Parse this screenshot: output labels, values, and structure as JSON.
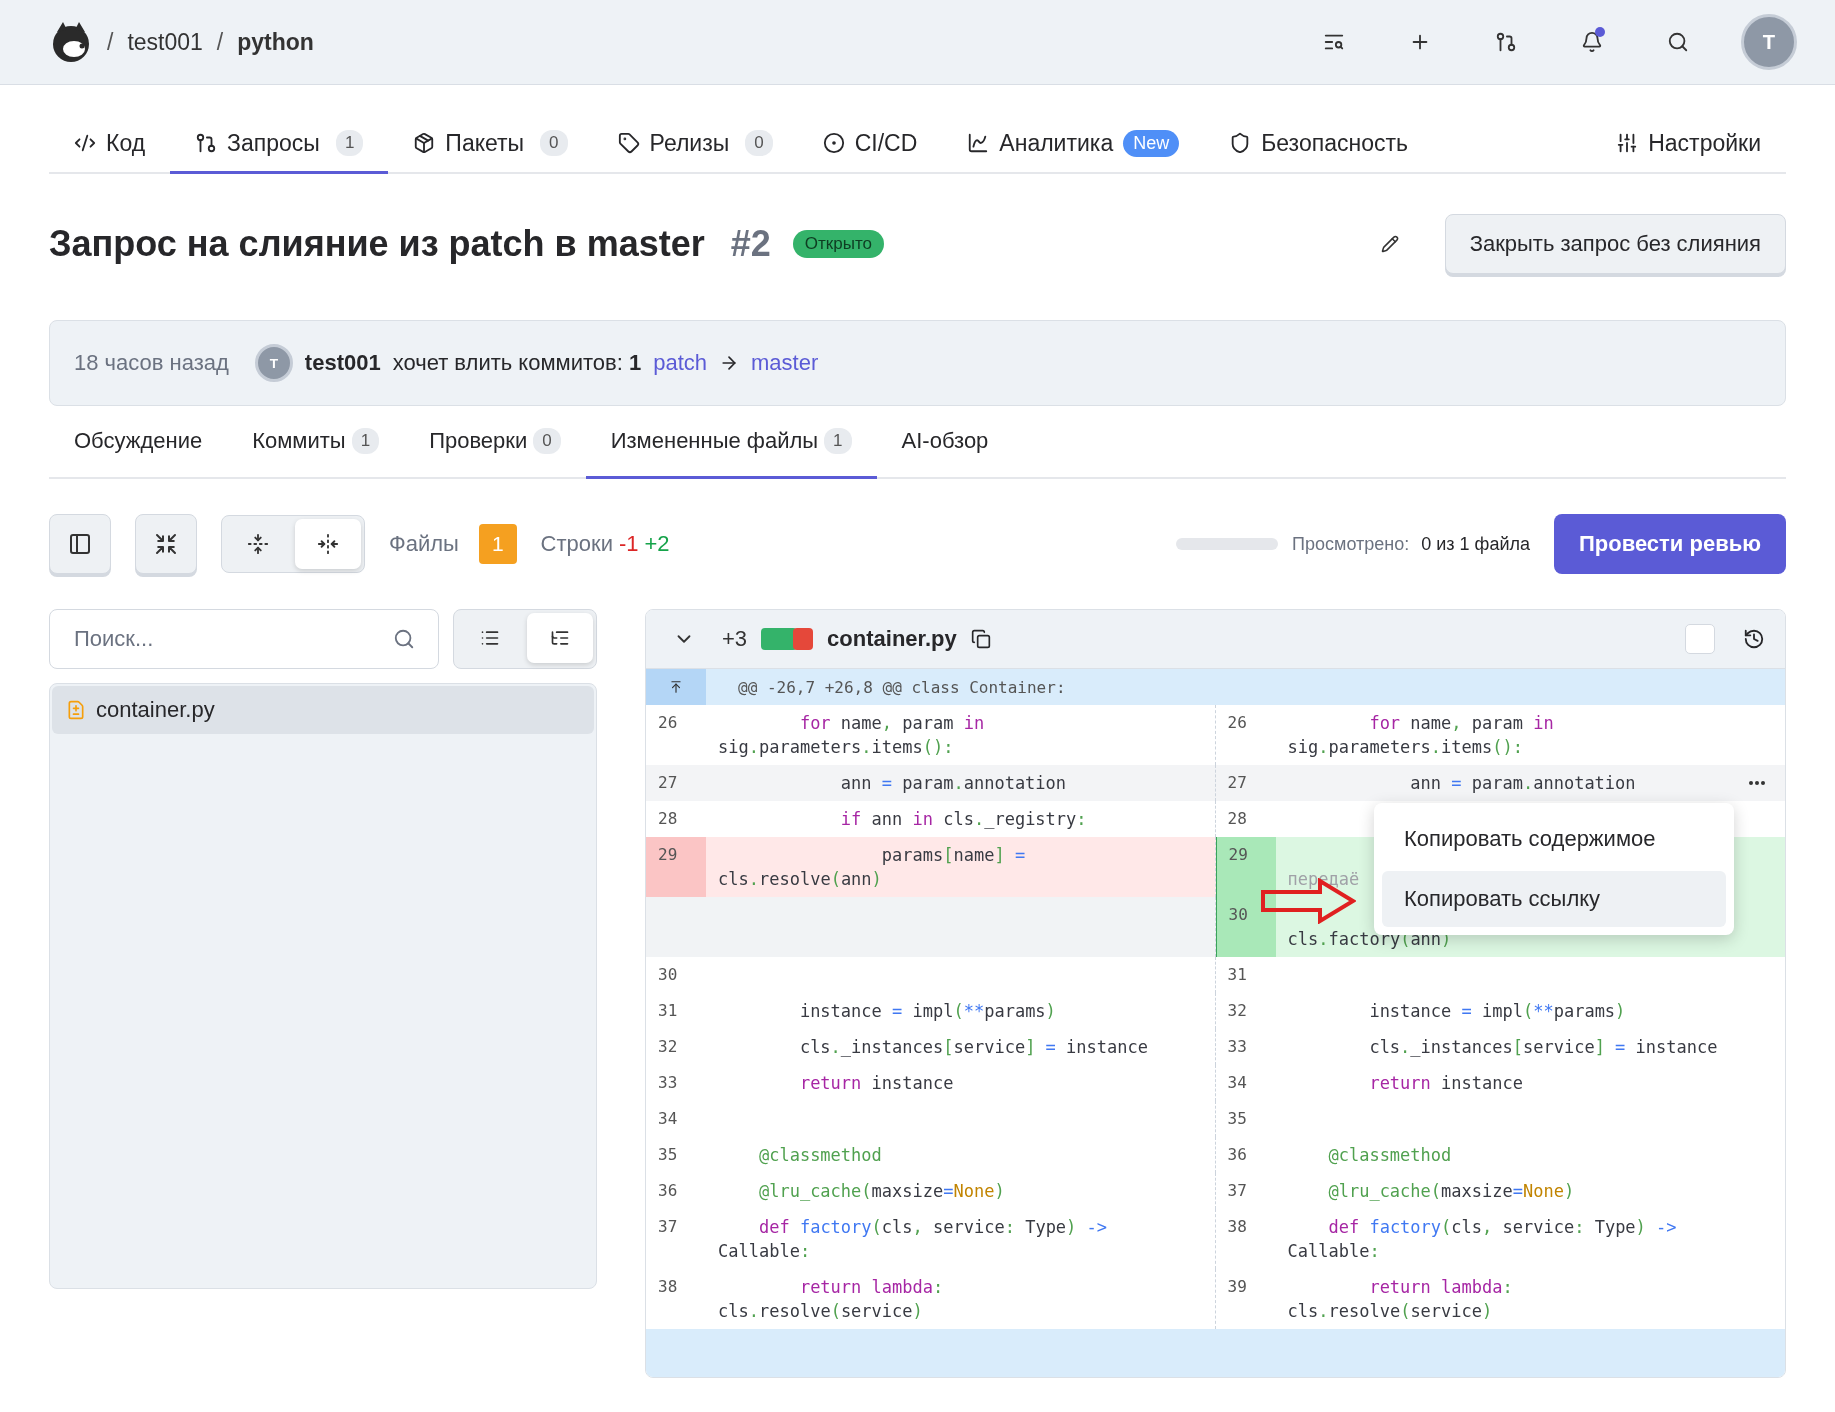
{
  "header": {
    "breadcrumb": [
      {
        "sep": "/",
        "label": "test001",
        "bold": false
      },
      {
        "sep": "/",
        "label": "python",
        "bold": true
      }
    ],
    "actions": [
      {
        "kind": "find"
      },
      {
        "kind": "plus"
      },
      {
        "kind": "pull"
      },
      {
        "kind": "bell",
        "unread": true
      },
      {
        "kind": "search"
      }
    ],
    "avatar": "T"
  },
  "nav": {
    "tabs": [
      {
        "kind": "code",
        "label": "Код",
        "selected": false
      },
      {
        "kind": "pull",
        "label": "Запросы",
        "count": "1",
        "selected": true
      },
      {
        "kind": "package",
        "label": "Пакеты",
        "count": "0",
        "selected": false
      },
      {
        "kind": "tag",
        "label": "Релизы",
        "count": "0",
        "selected": false
      },
      {
        "kind": "ci",
        "label": "CI/CD",
        "selected": false
      },
      {
        "kind": "chart",
        "label": "Аналитика",
        "badge": "New",
        "selected": false
      },
      {
        "kind": "shield",
        "label": "Безопасность",
        "selected": false
      }
    ],
    "settings": {
      "kind": "sliders",
      "label": "Настройки",
      "selected": false
    }
  },
  "title": {
    "text": "Запрос на слияние из patch в master",
    "number": "#2",
    "status": "Открыто",
    "close_button": "Закрыть запрос без слияния"
  },
  "info": {
    "time": "18 часов назад",
    "avatar": "T",
    "author": "test001",
    "text": "хочет влить коммитов: **1**",
    "source": "patch",
    "target": "master"
  },
  "subtabs": [
    {
      "label": "Обсуждение",
      "selected": false
    },
    {
      "label": "Коммиты",
      "count": "1",
      "selected": false
    },
    {
      "label": "Проверки",
      "count": "0",
      "selected": false
    },
    {
      "label": "Измененные файлы",
      "count": "1",
      "selected": true
    },
    {
      "label": "AI-обзор",
      "selected": false
    }
  ],
  "toolbar": {
    "tools": [
      {
        "kind": "sidebar"
      },
      {
        "kind": "collapse"
      }
    ],
    "view_modes": [
      {
        "kind": "unified",
        "selected": false
      },
      {
        "kind": "split",
        "selected": true
      }
    ],
    "files_label": "Файлы",
    "files_count": "1",
    "lines_label": "Строки",
    "removed": "-1",
    "added": "+2",
    "progress": {
      "level": 0
    },
    "viewed_label": "Просмотрено:",
    "viewed_value": "0 из 1 файла",
    "review_button": "Провести ревью"
  },
  "sidebar": {
    "search": {
      "placeholder": "Поиск..."
    },
    "modes": [
      {
        "kind": "list",
        "selected": false
      },
      {
        "kind": "tree",
        "selected": true
      }
    ],
    "files": [
      {
        "name": "container.py",
        "selected": true
      }
    ]
  },
  "diff": {
    "expanded": true,
    "additions": "+3",
    "file": "container.py",
    "viewed": false,
    "hunk": "@@ -26,7 +26,8 @@ class Container:",
    "rows": [
      {
        "highlighted": false,
        "left": {
          "kind": "context",
          "num": "26",
          "code": [
            {
              "text": "        for",
              "kind": "kw"
            },
            {
              "text": " name",
              "kind": "name"
            },
            {
              "text": ",",
              "kind": "punct"
            },
            {
              "text": " param ",
              "kind": "name"
            },
            {
              "text": "in",
              "kind": "kw"
            },
            {
              "text": " sig",
              "kind": "name"
            },
            {
              "text": ".",
              "kind": "punct"
            },
            {
              "text": "parameters",
              "kind": "name"
            },
            {
              "text": ".",
              "kind": "punct"
            },
            {
              "text": "items",
              "kind": "name"
            },
            {
              "text": "():",
              "kind": "punct"
            }
          ]
        },
        "right": {
          "kind": "context",
          "num": "26",
          "code": [
            {
              "text": "        for",
              "kind": "kw"
            },
            {
              "text": " name",
              "kind": "name"
            },
            {
              "text": ",",
              "kind": "punct"
            },
            {
              "text": " param ",
              "kind": "name"
            },
            {
              "text": "in",
              "kind": "kw"
            },
            {
              "text": " sig",
              "kind": "name"
            },
            {
              "text": ".",
              "kind": "punct"
            },
            {
              "text": "parameters",
              "kind": "name"
            },
            {
              "text": ".",
              "kind": "punct"
            },
            {
              "text": "items",
              "kind": "name"
            },
            {
              "text": "():",
              "kind": "punct"
            }
          ]
        }
      },
      {
        "highlighted": true,
        "left": {
          "kind": "context",
          "num": "27",
          "code": [
            {
              "text": "            ann ",
              "kind": "name"
            },
            {
              "text": "=",
              "kind": "op"
            },
            {
              "text": " param",
              "kind": "name"
            },
            {
              "text": ".",
              "kind": "punct"
            },
            {
              "text": "annotation",
              "kind": "name"
            }
          ]
        },
        "right": {
          "kind": "context",
          "num": "27",
          "code": [
            {
              "text": "            ann ",
              "kind": "name"
            },
            {
              "text": "=",
              "kind": "op"
            },
            {
              "text": " param",
              "kind": "name"
            },
            {
              "text": ".",
              "kind": "punct"
            },
            {
              "text": "annotation",
              "kind": "name"
            }
          ]
        }
      },
      {
        "highlighted": false,
        "left": {
          "kind": "context",
          "num": "28",
          "code": [
            {
              "text": "            if",
              "kind": "kw"
            },
            {
              "text": " ann ",
              "kind": "name"
            },
            {
              "text": "in",
              "kind": "kw"
            },
            {
              "text": " cls",
              "kind": "name"
            },
            {
              "text": ".",
              "kind": "punct"
            },
            {
              "text": "_registry",
              "kind": "name"
            },
            {
              "text": ":",
              "kind": "punct"
            }
          ]
        },
        "right": {
          "kind": "context",
          "num": "28"
        }
      },
      {
        "highlighted": false,
        "left": {
          "kind": "del",
          "num": "29",
          "code": [
            {
              "text": "                params",
              "kind": "name"
            },
            {
              "text": "[",
              "kind": "punct"
            },
            {
              "text": "name",
              "kind": "name"
            },
            {
              "text": "] ",
              "kind": "punct"
            },
            {
              "text": "=",
              "kind": "op"
            },
            {
              "text": " cls",
              "kind": "name"
            },
            {
              "text": ".",
              "kind": "punct"
            },
            {
              "text": "resolve",
              "kind": "name"
            },
            {
              "text": "(",
              "kind": "punct"
            },
            {
              "text": "ann",
              "kind": "name"
            },
            {
              "text": ")",
              "kind": "punct"
            }
          ]
        },
        "right": {
          "kind": "add",
          "num": "29",
          "overlapped": true,
          "code": [
            {
              "text": "передаё",
              "kind": "comment"
            }
          ]
        }
      },
      {
        "highlighted": false,
        "left": {
          "kind": "empty"
        },
        "right": {
          "kind": "add",
          "num": "30",
          "overlapped": true,
          "code": [
            {
              "text": "cls",
              "kind": "name"
            },
            {
              "text": ".",
              "kind": "punct"
            },
            {
              "text": "factory",
              "kind": "name"
            },
            {
              "text": "(",
              "kind": "punct"
            },
            {
              "text": "ann",
              "kind": "name"
            },
            {
              "text": ")",
              "kind": "punct"
            }
          ]
        }
      },
      {
        "highlighted": false,
        "left": {
          "kind": "context",
          "num": "30"
        },
        "right": {
          "kind": "context",
          "num": "31"
        }
      },
      {
        "highlighted": false,
        "left": {
          "kind": "context",
          "num": "31",
          "code": [
            {
              "text": "        instance ",
              "kind": "name"
            },
            {
              "text": "=",
              "kind": "op"
            },
            {
              "text": " impl",
              "kind": "name"
            },
            {
              "text": "(",
              "kind": "punct"
            },
            {
              "text": "**",
              "kind": "op"
            },
            {
              "text": "params",
              "kind": "name"
            },
            {
              "text": ")",
              "kind": "punct"
            }
          ]
        },
        "right": {
          "kind": "context",
          "num": "32",
          "code": [
            {
              "text": "        instance ",
              "kind": "name"
            },
            {
              "text": "=",
              "kind": "op"
            },
            {
              "text": " impl",
              "kind": "name"
            },
            {
              "text": "(",
              "kind": "punct"
            },
            {
              "text": "**",
              "kind": "op"
            },
            {
              "text": "params",
              "kind": "name"
            },
            {
              "text": ")",
              "kind": "punct"
            }
          ]
        }
      },
      {
        "highlighted": false,
        "left": {
          "kind": "context",
          "num": "32",
          "code": [
            {
              "text": "        cls",
              "kind": "name"
            },
            {
              "text": ".",
              "kind": "punct"
            },
            {
              "text": "_instances",
              "kind": "name"
            },
            {
              "text": "[",
              "kind": "punct"
            },
            {
              "text": "service",
              "kind": "name"
            },
            {
              "text": "] ",
              "kind": "punct"
            },
            {
              "text": "=",
              "kind": "op"
            },
            {
              "text": " instance",
              "kind": "name"
            }
          ]
        },
        "right": {
          "kind": "context",
          "num": "33",
          "code": [
            {
              "text": "        cls",
              "kind": "name"
            },
            {
              "text": ".",
              "kind": "punct"
            },
            {
              "text": "_instances",
              "kind": "name"
            },
            {
              "text": "[",
              "kind": "punct"
            },
            {
              "text": "service",
              "kind": "name"
            },
            {
              "text": "] ",
              "kind": "punct"
            },
            {
              "text": "=",
              "kind": "op"
            },
            {
              "text": " instance",
              "kind": "name"
            }
          ]
        }
      },
      {
        "highlighted": false,
        "left": {
          "kind": "context",
          "num": "33",
          "code": [
            {
              "text": "        return",
              "kind": "kw"
            },
            {
              "text": " instance",
              "kind": "name"
            }
          ]
        },
        "right": {
          "kind": "context",
          "num": "34",
          "code": [
            {
              "text": "        return",
              "kind": "kw"
            },
            {
              "text": " instance",
              "kind": "name"
            }
          ]
        }
      },
      {
        "highlighted": false,
        "left": {
          "kind": "context",
          "num": "34"
        },
        "right": {
          "kind": "context",
          "num": "35"
        }
      },
      {
        "highlighted": false,
        "left": {
          "kind": "context",
          "num": "35",
          "code": [
            {
              "text": "    @classmethod",
              "kind": "deco"
            }
          ]
        },
        "right": {
          "kind": "context",
          "num": "36",
          "code": [
            {
              "text": "    @classmethod",
              "kind": "deco"
            }
          ]
        }
      },
      {
        "highlighted": false,
        "left": {
          "kind": "context",
          "num": "36",
          "code": [
            {
              "text": "    @lru_cache",
              "kind": "deco"
            },
            {
              "text": "(",
              "kind": "punct"
            },
            {
              "text": "maxsize",
              "kind": "name"
            },
            {
              "text": "=",
              "kind": "op"
            },
            {
              "text": "None",
              "kind": "const"
            },
            {
              "text": ")",
              "kind": "punct"
            }
          ]
        },
        "right": {
          "kind": "context",
          "num": "37",
          "code": [
            {
              "text": "    @lru_cache",
              "kind": "deco"
            },
            {
              "text": "(",
              "kind": "punct"
            },
            {
              "text": "maxsize",
              "kind": "name"
            },
            {
              "text": "=",
              "kind": "op"
            },
            {
              "text": "None",
              "kind": "const"
            },
            {
              "text": ")",
              "kind": "punct"
            }
          ]
        }
      },
      {
        "highlighted": false,
        "left": {
          "kind": "context",
          "num": "37",
          "code": [
            {
              "text": "    def",
              "kind": "kw"
            },
            {
              "text": " factory",
              "kind": "func"
            },
            {
              "text": "(",
              "kind": "punct"
            },
            {
              "text": "cls",
              "kind": "name"
            },
            {
              "text": ",",
              "kind": "punct"
            },
            {
              "text": " service",
              "kind": "name"
            },
            {
              "text": ":",
              "kind": "punct"
            },
            {
              "text": " Type",
              "kind": "name"
            },
            {
              "text": ") ",
              "kind": "punct"
            },
            {
              "text": "->",
              "kind": "op"
            },
            {
              "text": " Callable",
              "kind": "name"
            },
            {
              "text": ":",
              "kind": "punct"
            }
          ]
        },
        "right": {
          "kind": "context",
          "num": "38",
          "code": [
            {
              "text": "    def",
              "kind": "kw"
            },
            {
              "text": " factory",
              "kind": "func"
            },
            {
              "text": "(",
              "kind": "punct"
            },
            {
              "text": "cls",
              "kind": "name"
            },
            {
              "text": ",",
              "kind": "punct"
            },
            {
              "text": " service",
              "kind": "name"
            },
            {
              "text": ":",
              "kind": "punct"
            },
            {
              "text": " Type",
              "kind": "name"
            },
            {
              "text": ") ",
              "kind": "punct"
            },
            {
              "text": "->",
              "kind": "op"
            },
            {
              "text": " Callable",
              "kind": "name"
            },
            {
              "text": ":",
              "kind": "punct"
            }
          ]
        }
      },
      {
        "highlighted": false,
        "left": {
          "kind": "context",
          "num": "38",
          "code": [
            {
              "text": "        return",
              "kind": "kw"
            },
            {
              "text": " lambda",
              "kind": "kw"
            },
            {
              "text": ":",
              "kind": "punct"
            },
            {
              "text": " cls",
              "kind": "name"
            },
            {
              "text": ".",
              "kind": "punct"
            },
            {
              "text": "resolve",
              "kind": "name"
            },
            {
              "text": "(",
              "kind": "punct"
            },
            {
              "text": "service",
              "kind": "name"
            },
            {
              "text": ")",
              "kind": "punct"
            }
          ]
        },
        "right": {
          "kind": "context",
          "num": "39",
          "code": [
            {
              "text": "        return",
              "kind": "kw"
            },
            {
              "text": " lambda",
              "kind": "kw"
            },
            {
              "text": ":",
              "kind": "punct"
            },
            {
              "text": " cls",
              "kind": "name"
            },
            {
              "text": ".",
              "kind": "punct"
            },
            {
              "text": "resolve",
              "kind": "name"
            },
            {
              "text": "(",
              "kind": "punct"
            },
            {
              "text": "service",
              "kind": "name"
            },
            {
              "text": ")",
              "kind": "punct"
            }
          ]
        }
      }
    ],
    "menu": [
      {
        "label": "Копировать содержимое",
        "selected": false
      },
      {
        "label": "Копировать ссылку",
        "selected": true
      }
    ]
  }
}
